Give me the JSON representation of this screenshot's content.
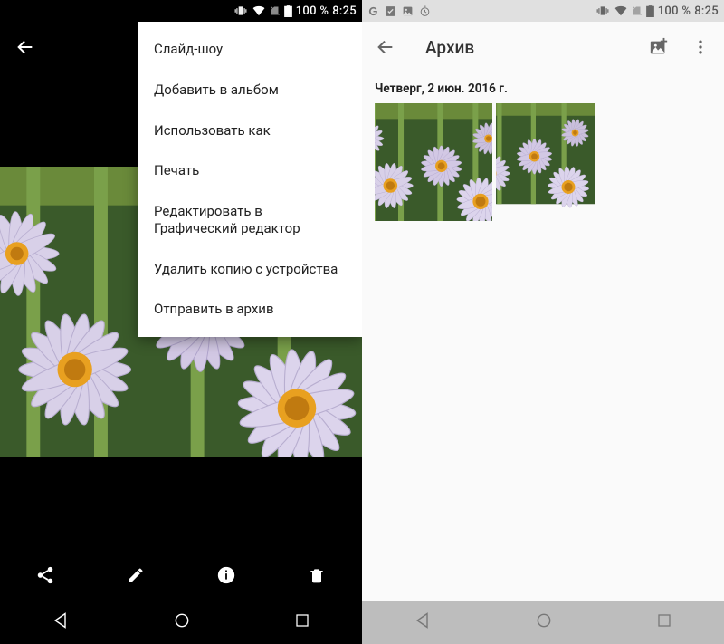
{
  "status": {
    "battery_text": "100 %",
    "time": "8:25"
  },
  "left": {
    "menu_items": [
      "Слайд-шоу",
      "Добавить в альбом",
      "Использовать как",
      "Печать",
      "Редактировать в Графический редактор",
      "Удалить копию с устройства",
      "Отправить в архив"
    ]
  },
  "right": {
    "title": "Архив",
    "date_header": "Четверг, 2 июн. 2016 г."
  }
}
